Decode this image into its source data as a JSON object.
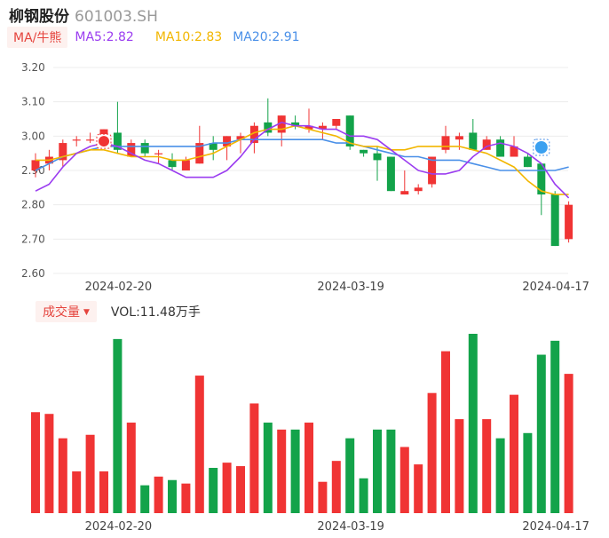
{
  "header": {
    "stock_name": "柳钢股份",
    "stock_code": "601003.SH"
  },
  "ma_legend": {
    "label": "MA/牛熊",
    "ma5": "MA5:2.82",
    "ma10": "MA10:2.83",
    "ma20": "MA20:2.91",
    "colors": {
      "ma5": "#9b3df0",
      "ma10": "#f2b600",
      "ma20": "#4a90e8"
    }
  },
  "volume_legend": {
    "label": "成交量",
    "value": "VOL:11.48万手"
  },
  "colors": {
    "up": "#f03434",
    "down": "#13a34a"
  },
  "markers": [
    "bull-marker-icon",
    "bear-marker-icon"
  ],
  "chart_data": {
    "type": "candlestick",
    "y_ticks": [
      "3.20",
      "3.10",
      "3.00",
      "2.90",
      "2.80",
      "2.70",
      "2.60"
    ],
    "ylim": [
      2.6,
      3.2
    ],
    "x_tick_labels": [
      {
        "index": 6,
        "label": "2024-02-20"
      },
      {
        "index": 23,
        "label": "2024-03-19"
      },
      {
        "index": 38,
        "label": "2024-04-17"
      }
    ],
    "candles": [
      {
        "o": 2.9,
        "c": 2.93,
        "h": 2.95,
        "l": 2.88
      },
      {
        "o": 2.92,
        "c": 2.94,
        "h": 2.96,
        "l": 2.9
      },
      {
        "o": 2.93,
        "c": 2.98,
        "h": 2.99,
        "l": 2.91
      },
      {
        "o": 2.99,
        "c": 2.99,
        "h": 3.0,
        "l": 2.97
      },
      {
        "o": 2.99,
        "c": 2.99,
        "h": 3.01,
        "l": 2.98
      },
      {
        "o": 2.98,
        "c": 3.02,
        "h": 3.02,
        "l": 2.97
      },
      {
        "o": 3.01,
        "c": 2.96,
        "h": 3.1,
        "l": 2.95
      },
      {
        "o": 2.94,
        "c": 2.98,
        "h": 2.99,
        "l": 2.94
      },
      {
        "o": 2.98,
        "c": 2.95,
        "h": 2.99,
        "l": 2.94
      },
      {
        "o": 2.95,
        "c": 2.95,
        "h": 2.96,
        "l": 2.92
      },
      {
        "o": 2.93,
        "c": 2.91,
        "h": 2.95,
        "l": 2.9
      },
      {
        "o": 2.9,
        "c": 2.93,
        "h": 2.94,
        "l": 2.9
      },
      {
        "o": 2.92,
        "c": 2.98,
        "h": 3.03,
        "l": 2.92
      },
      {
        "o": 2.98,
        "c": 2.96,
        "h": 3.0,
        "l": 2.93
      },
      {
        "o": 2.97,
        "c": 3.0,
        "h": 3.0,
        "l": 2.93
      },
      {
        "o": 2.99,
        "c": 3.0,
        "h": 3.01,
        "l": 2.95
      },
      {
        "o": 2.98,
        "c": 3.03,
        "h": 3.04,
        "l": 2.95
      },
      {
        "o": 3.04,
        "c": 3.01,
        "h": 3.11,
        "l": 3.0
      },
      {
        "o": 3.01,
        "c": 3.06,
        "h": 3.06,
        "l": 2.97
      },
      {
        "o": 3.04,
        "c": 3.03,
        "h": 3.06,
        "l": 3.02
      },
      {
        "o": 3.02,
        "c": 3.03,
        "h": 3.08,
        "l": 3.01
      },
      {
        "o": 3.02,
        "c": 3.03,
        "h": 3.04,
        "l": 2.99
      },
      {
        "o": 3.03,
        "c": 3.05,
        "h": 3.05,
        "l": 3.02
      },
      {
        "o": 3.06,
        "c": 2.97,
        "h": 3.06,
        "l": 2.96
      },
      {
        "o": 2.96,
        "c": 2.95,
        "h": 2.96,
        "l": 2.94
      },
      {
        "o": 2.95,
        "c": 2.93,
        "h": 2.97,
        "l": 2.87
      },
      {
        "o": 2.94,
        "c": 2.84,
        "h": 2.94,
        "l": 2.84
      },
      {
        "o": 2.83,
        "c": 2.84,
        "h": 2.9,
        "l": 2.83
      },
      {
        "o": 2.84,
        "c": 2.85,
        "h": 2.86,
        "l": 2.83
      },
      {
        "o": 2.86,
        "c": 2.94,
        "h": 2.94,
        "l": 2.85
      },
      {
        "o": 2.96,
        "c": 3.0,
        "h": 3.03,
        "l": 2.95
      },
      {
        "o": 2.99,
        "c": 3.0,
        "h": 3.01,
        "l": 2.96
      },
      {
        "o": 3.01,
        "c": 2.96,
        "h": 3.05,
        "l": 2.96
      },
      {
        "o": 2.96,
        "c": 2.99,
        "h": 3.0,
        "l": 2.96
      },
      {
        "o": 2.99,
        "c": 2.94,
        "h": 3.0,
        "l": 2.94
      },
      {
        "o": 2.94,
        "c": 2.97,
        "h": 3.0,
        "l": 2.94
      },
      {
        "o": 2.94,
        "c": 2.91,
        "h": 2.95,
        "l": 2.91
      },
      {
        "o": 2.92,
        "c": 2.83,
        "h": 2.92,
        "l": 2.77
      },
      {
        "o": 2.83,
        "c": 2.68,
        "h": 2.84,
        "l": 2.68
      },
      {
        "o": 2.7,
        "c": 2.8,
        "h": 2.81,
        "l": 2.69
      }
    ],
    "ma5": [
      2.84,
      2.86,
      2.91,
      2.95,
      2.97,
      2.98,
      2.97,
      2.95,
      2.93,
      2.92,
      2.9,
      2.88,
      2.88,
      2.88,
      2.9,
      2.94,
      2.99,
      3.02,
      3.04,
      3.03,
      3.03,
      3.02,
      3.02,
      3.0,
      3.0,
      2.99,
      2.96,
      2.93,
      2.9,
      2.89,
      2.89,
      2.9,
      2.94,
      2.97,
      2.98,
      2.97,
      2.95,
      2.92,
      2.86,
      2.82
    ],
    "ma10": [
      2.93,
      2.93,
      2.94,
      2.95,
      2.96,
      2.96,
      2.95,
      2.94,
      2.94,
      2.94,
      2.93,
      2.93,
      2.94,
      2.95,
      2.97,
      2.99,
      3.01,
      3.02,
      3.02,
      3.03,
      3.02,
      3.01,
      3.0,
      2.98,
      2.97,
      2.97,
      2.96,
      2.96,
      2.97,
      2.97,
      2.97,
      2.97,
      2.96,
      2.95,
      2.93,
      2.91,
      2.87,
      2.84,
      2.83,
      2.83
    ],
    "ma20": [
      2.9,
      2.92,
      2.94,
      2.95,
      2.96,
      2.97,
      2.97,
      2.97,
      2.97,
      2.97,
      2.97,
      2.97,
      2.97,
      2.98,
      2.98,
      2.99,
      2.99,
      2.99,
      2.99,
      2.99,
      2.99,
      2.99,
      2.98,
      2.98,
      2.97,
      2.96,
      2.95,
      2.94,
      2.94,
      2.93,
      2.93,
      2.93,
      2.92,
      2.91,
      2.9,
      2.9,
      2.9,
      2.9,
      2.9,
      2.91
    ],
    "bull_marker_index": 5,
    "bear_marker_index": 37,
    "volume": [
      58,
      57,
      43,
      24,
      45,
      24,
      100,
      52,
      16,
      21,
      19,
      17,
      79,
      26,
      29,
      27,
      63,
      52,
      48,
      48,
      52,
      18,
      30,
      43,
      20,
      48,
      48,
      38,
      28,
      69,
      93,
      54,
      103,
      54,
      43,
      68,
      46,
      91,
      99,
      80
    ],
    "volume_up": [
      true,
      true,
      true,
      true,
      true,
      true,
      false,
      true,
      false,
      true,
      false,
      true,
      true,
      false,
      true,
      true,
      true,
      false,
      true,
      false,
      true,
      true,
      true,
      false,
      false,
      false,
      false,
      true,
      true,
      true,
      true,
      true,
      false,
      true,
      false,
      true,
      false,
      false,
      false,
      true
    ]
  }
}
